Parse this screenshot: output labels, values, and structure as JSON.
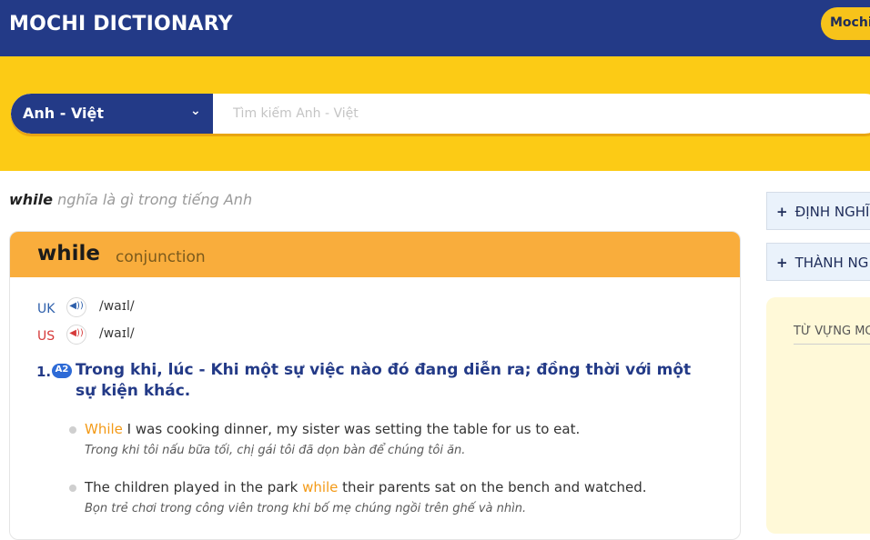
{
  "header": {
    "logo": "MOCHI DICTIONARY",
    "mochi_button": "Mochi"
  },
  "search": {
    "language": "Anh - Việt",
    "placeholder": "Tìm kiếm Anh - Việt",
    "value": ""
  },
  "page": {
    "query_word": "while",
    "meaning_suffix": "nghĩa là gì trong tiếng Anh"
  },
  "entry": {
    "word": "while",
    "part_of_speech": "conjunction",
    "pronunciations": [
      {
        "region": "UK",
        "ipa": "/waɪl/"
      },
      {
        "region": "US",
        "ipa": "/waɪl/"
      }
    ],
    "definition": {
      "number": "1.",
      "level": "A2",
      "text": "Trong khi, lúc - Khi một sự việc nào đó đang diễn ra; đồng thời với một sự kiện khác."
    },
    "examples": [
      {
        "keyword": "While",
        "rest": " I was cooking dinner, my sister was setting the table for us to eat.",
        "translation": "Trong khi tôi nấu bữa tối, chị gái tôi đã dọn bàn để chúng tôi ăn."
      },
      {
        "before": "The children played in the park ",
        "keyword": "while",
        "after": " their parents sat on the bench and watched.",
        "translation": "Bọn trẻ chơi trong công viên trong khi bố mẹ chúng ngồi trên ghế và nhìn."
      }
    ]
  },
  "sidebar": {
    "items": [
      {
        "label": "ĐỊNH NGHĨ"
      },
      {
        "label": "THÀNH NG"
      }
    ],
    "box_title": "TỪ VỰNG MC"
  },
  "colors": {
    "navy": "#233a87",
    "yellow": "#fccb15",
    "orange": "#f9ad3c",
    "keyword": "#f39a17"
  },
  "icons": {
    "speaker": "speaker-icon",
    "chevron": "chevron-down-icon",
    "plus": "plus-icon"
  }
}
